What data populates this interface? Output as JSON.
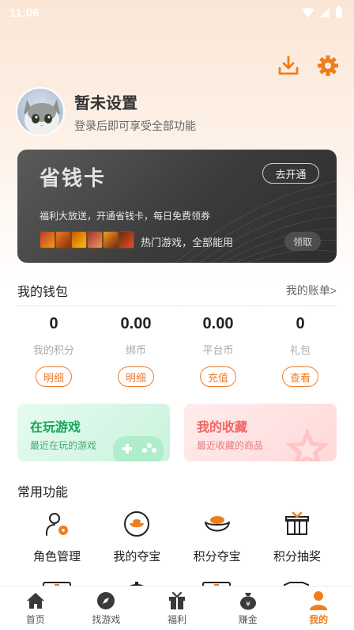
{
  "status": {
    "time": "11:06"
  },
  "profile": {
    "name": "暂未设置",
    "subtitle": "登录后即可享受全部功能"
  },
  "card": {
    "title": "省钱卡",
    "open_label": "去开通",
    "desc": "福利大放送，开通省钱卡，每日免费领券",
    "games_text": "热门游戏，全部能用",
    "claim_label": "领取"
  },
  "wallet": {
    "title": "我的钱包",
    "link": "我的账单>",
    "items": [
      {
        "value": "0",
        "label": "我的积分",
        "button": "明细"
      },
      {
        "value": "0.00",
        "label": "绑币",
        "button": "明细"
      },
      {
        "value": "0.00",
        "label": "平台币",
        "button": "充值"
      },
      {
        "value": "0",
        "label": "礼包",
        "button": "查看"
      }
    ]
  },
  "tiles": {
    "playing": {
      "title": "在玩游戏",
      "subtitle": "最近在玩的游戏"
    },
    "favorites": {
      "title": "我的收藏",
      "subtitle": "最近收藏的商品"
    }
  },
  "functions": {
    "title": "常用功能",
    "items": [
      {
        "label": "角色管理",
        "icon": "role-manage-icon"
      },
      {
        "label": "我的夺宝",
        "icon": "treasure-icon"
      },
      {
        "label": "积分夺宝",
        "icon": "ingot-icon"
      },
      {
        "label": "积分抽奖",
        "icon": "gift-box-icon"
      }
    ]
  },
  "tabs": [
    {
      "label": "首页",
      "icon": "home-icon"
    },
    {
      "label": "找游戏",
      "icon": "compass-icon"
    },
    {
      "label": "福利",
      "icon": "gift-icon"
    },
    {
      "label": "赚金",
      "icon": "money-bag-icon"
    },
    {
      "label": "我的",
      "icon": "user-icon",
      "active": true
    }
  ],
  "colors": {
    "accent": "#f07e1c",
    "card_dark": "#3b3b3b",
    "green": "#18a559",
    "red": "#f06464"
  }
}
